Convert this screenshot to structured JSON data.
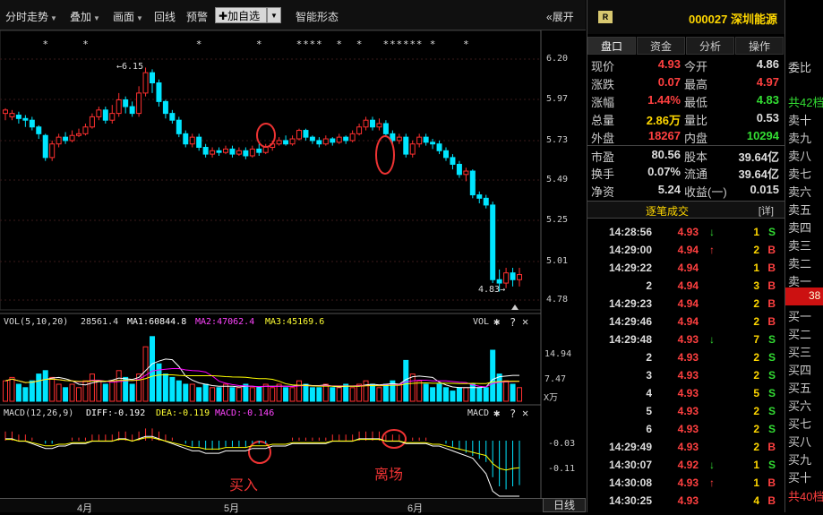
{
  "toolbar": {
    "intraday": "分时走势",
    "overlay": "叠加",
    "draw": "画面",
    "back": "回线",
    "warn": "预警",
    "add": "加自选",
    "smart": "智能形态",
    "expand": "展开"
  },
  "stock": {
    "badge": "R",
    "code": "000027",
    "name": "深圳能源"
  },
  "tabs": [
    "盘口",
    "资金",
    "分析",
    "操作"
  ],
  "quote": {
    "rows": [
      [
        {
          "l": "现价",
          "v": "4.93",
          "c": "#ff4040"
        },
        {
          "l": "今开",
          "v": "4.86",
          "c": "#ddd"
        }
      ],
      [
        {
          "l": "涨跌",
          "v": "0.07",
          "c": "#ff4040"
        },
        {
          "l": "最高",
          "v": "4.97",
          "c": "#ff4040"
        }
      ],
      [
        {
          "l": "涨幅",
          "v": "1.44%",
          "c": "#ff4040"
        },
        {
          "l": "最低",
          "v": "4.83",
          "c": "#33dd33"
        }
      ],
      [
        {
          "l": "总量",
          "v": "2.86万",
          "c": "#ffd700"
        },
        {
          "l": "量比",
          "v": "0.53",
          "c": "#ddd"
        }
      ],
      [
        {
          "l": "外盘",
          "v": "18267",
          "c": "#ff4040"
        },
        {
          "l": "内盘",
          "v": "10294",
          "c": "#33dd33"
        }
      ],
      [
        {
          "l": "市盈",
          "v": "80.56",
          "c": "#ddd"
        },
        {
          "l": "股本",
          "v": "39.64亿",
          "c": "#ddd"
        }
      ],
      [
        {
          "l": "换手",
          "v": "0.07%",
          "c": "#ddd"
        },
        {
          "l": "流通",
          "v": "39.64亿",
          "c": "#ddd"
        }
      ],
      [
        {
          "l": "净资",
          "v": "5.24",
          "c": "#ddd"
        },
        {
          "l": "收益(一)",
          "v": "0.015",
          "c": "#ddd"
        }
      ]
    ]
  },
  "ticks_header": {
    "title": "逐笔成交",
    "detail": "[详]"
  },
  "ticks": [
    {
      "t": "14:28:56",
      "p": "4.93",
      "a": "↓",
      "ac": "#33dd33",
      "q": "1",
      "s": "S"
    },
    {
      "t": "14:29:00",
      "p": "4.94",
      "a": "↑",
      "ac": "#ff4040",
      "q": "2",
      "s": "B"
    },
    {
      "t": "14:29:22",
      "p": "4.94",
      "a": "",
      "ac": "#ff4040",
      "q": "1",
      "s": "B"
    },
    {
      "t": "2",
      "p": "4.94",
      "a": "",
      "ac": "#ff4040",
      "q": "3",
      "s": "B"
    },
    {
      "t": "14:29:23",
      "p": "4.94",
      "a": "",
      "ac": "#ff4040",
      "q": "2",
      "s": "B"
    },
    {
      "t": "14:29:46",
      "p": "4.94",
      "a": "",
      "ac": "#ff4040",
      "q": "2",
      "s": "B"
    },
    {
      "t": "14:29:48",
      "p": "4.93",
      "a": "↓",
      "ac": "#33dd33",
      "q": "7",
      "s": "S"
    },
    {
      "t": "2",
      "p": "4.93",
      "a": "",
      "ac": "#ff4040",
      "q": "2",
      "s": "S"
    },
    {
      "t": "3",
      "p": "4.93",
      "a": "",
      "ac": "#ff4040",
      "q": "2",
      "s": "S"
    },
    {
      "t": "4",
      "p": "4.93",
      "a": "",
      "ac": "#ff4040",
      "q": "5",
      "s": "S"
    },
    {
      "t": "5",
      "p": "4.93",
      "a": "",
      "ac": "#ff4040",
      "q": "2",
      "s": "S"
    },
    {
      "t": "6",
      "p": "4.93",
      "a": "",
      "ac": "#ff4040",
      "q": "2",
      "s": "S"
    },
    {
      "t": "14:29:49",
      "p": "4.93",
      "a": "",
      "ac": "#ff4040",
      "q": "2",
      "s": "B"
    },
    {
      "t": "14:30:07",
      "p": "4.92",
      "a": "↓",
      "ac": "#33dd33",
      "q": "1",
      "s": "S"
    },
    {
      "t": "14:30:08",
      "p": "4.93",
      "a": "↑",
      "ac": "#ff4040",
      "q": "1",
      "s": "B"
    },
    {
      "t": "14:30:25",
      "p": "4.93",
      "a": "",
      "ac": "#ff4040",
      "q": "4",
      "s": "B"
    }
  ],
  "orderbook": {
    "ratio": "委比",
    "sell_total": "共42档",
    "sells": [
      "卖十",
      "卖九",
      "卖八",
      "卖七",
      "卖六",
      "卖五",
      "卖四",
      "卖三",
      "卖二",
      "卖一"
    ],
    "mid": "38",
    "buys": [
      "买一",
      "买二",
      "买三",
      "买四",
      "买五",
      "买六",
      "买七",
      "买八",
      "买九",
      "买十"
    ],
    "buy_total": "共40档"
  },
  "price_axis": [
    "6.20",
    "5.97",
    "5.73",
    "5.49",
    "5.25",
    "5.01",
    "4.78"
  ],
  "labels": {
    "hi": "←6.15",
    "lo": "4.83→"
  },
  "vol": {
    "title": "VOL(5,10,20)",
    "val": "28561.4",
    "ma1": "MA1:60844.8",
    "ma2": "MA2:47062.4",
    "ma3": "MA3:45169.6",
    "btn": "VOL",
    "axis": [
      "14.94",
      "7.47"
    ],
    "unit": "X万"
  },
  "macd": {
    "title": "MACD(12,26,9)",
    "diff": "DIFF:-0.192",
    "dea": "DEA:-0.119",
    "macdv": "MACD:-0.146",
    "btn": "MACD",
    "axis": [
      "-0.03",
      "-0.11"
    ]
  },
  "ann": {
    "buy": "买入",
    "sell": "离场"
  },
  "months": [
    "4月",
    "5月",
    "6月"
  ],
  "period": "日线",
  "colors": {
    "up": "#ff3030",
    "down": "#00e5ff",
    "ma1": "#ffffff",
    "ma2": "#ffff00",
    "ma3": "#ff00ff",
    "macdma": "#33ff33"
  },
  "chart_data": {
    "type": "candlestick",
    "ylim": [
      4.78,
      6.2
    ],
    "hi": 6.15,
    "lo": 4.83,
    "candles": [
      [
        5.88,
        5.9,
        5.84,
        5.91
      ],
      [
        5.86,
        5.88,
        5.84,
        5.9
      ],
      [
        5.87,
        5.85,
        5.82,
        5.89
      ],
      [
        5.85,
        5.84,
        5.8,
        5.87
      ],
      [
        5.84,
        5.8,
        5.78,
        5.86
      ],
      [
        5.8,
        5.76,
        5.73,
        5.81
      ],
      [
        5.75,
        5.62,
        5.6,
        5.76
      ],
      [
        5.62,
        5.7,
        5.6,
        5.72
      ],
      [
        5.7,
        5.74,
        5.68,
        5.76
      ],
      [
        5.74,
        5.72,
        5.7,
        5.77
      ],
      [
        5.72,
        5.75,
        5.71,
        5.78
      ],
      [
        5.75,
        5.76,
        5.74,
        5.79
      ],
      [
        5.76,
        5.8,
        5.75,
        5.82
      ],
      [
        5.8,
        5.86,
        5.79,
        5.88
      ],
      [
        5.86,
        5.9,
        5.84,
        5.92
      ],
      [
        5.9,
        5.84,
        5.82,
        5.92
      ],
      [
        5.84,
        5.88,
        5.82,
        5.93
      ],
      [
        5.88,
        5.96,
        5.86,
        6.0
      ],
      [
        5.96,
        5.92,
        5.88,
        5.98
      ],
      [
        5.92,
        5.88,
        5.86,
        5.95
      ],
      [
        5.88,
        6.0,
        5.86,
        6.04
      ],
      [
        6.0,
        6.12,
        5.98,
        6.15
      ],
      [
        6.12,
        6.06,
        6.0,
        6.14
      ],
      [
        6.06,
        5.95,
        5.92,
        6.08
      ],
      [
        5.95,
        5.88,
        5.85,
        5.96
      ],
      [
        5.88,
        5.84,
        5.82,
        5.9
      ],
      [
        5.84,
        5.76,
        5.74,
        5.86
      ],
      [
        5.76,
        5.7,
        5.68,
        5.78
      ],
      [
        5.7,
        5.74,
        5.68,
        5.76
      ],
      [
        5.74,
        5.68,
        5.66,
        5.76
      ],
      [
        5.68,
        5.64,
        5.62,
        5.7
      ],
      [
        5.64,
        5.66,
        5.62,
        5.68
      ],
      [
        5.66,
        5.65,
        5.63,
        5.68
      ],
      [
        5.65,
        5.67,
        5.64,
        5.69
      ],
      [
        5.67,
        5.64,
        5.62,
        5.69
      ],
      [
        5.64,
        5.66,
        5.63,
        5.68
      ],
      [
        5.66,
        5.63,
        5.61,
        5.68
      ],
      [
        5.63,
        5.67,
        5.62,
        5.69
      ],
      [
        5.67,
        5.65,
        5.63,
        5.7
      ],
      [
        5.65,
        5.68,
        5.64,
        5.7
      ],
      [
        5.68,
        5.7,
        5.66,
        5.72
      ],
      [
        5.7,
        5.72,
        5.69,
        5.74
      ],
      [
        5.72,
        5.7,
        5.69,
        5.75
      ],
      [
        5.7,
        5.73,
        5.69,
        5.75
      ],
      [
        5.73,
        5.78,
        5.72,
        5.79
      ],
      [
        5.78,
        5.74,
        5.72,
        5.79
      ],
      [
        5.74,
        5.72,
        5.7,
        5.75
      ],
      [
        5.72,
        5.7,
        5.68,
        5.74
      ],
      [
        5.7,
        5.73,
        5.69,
        5.75
      ],
      [
        5.73,
        5.71,
        5.69,
        5.74
      ],
      [
        5.71,
        5.74,
        5.7,
        5.76
      ],
      [
        5.74,
        5.72,
        5.7,
        5.75
      ],
      [
        5.72,
        5.76,
        5.71,
        5.78
      ],
      [
        5.76,
        5.8,
        5.75,
        5.82
      ],
      [
        5.8,
        5.84,
        5.78,
        5.86
      ],
      [
        5.84,
        5.8,
        5.78,
        5.86
      ],
      [
        5.8,
        5.82,
        5.78,
        5.85
      ],
      [
        5.82,
        5.76,
        5.74,
        5.84
      ],
      [
        5.76,
        5.72,
        5.7,
        5.78
      ],
      [
        5.72,
        5.74,
        5.7,
        5.76
      ],
      [
        5.74,
        5.64,
        5.62,
        5.76
      ],
      [
        5.64,
        5.7,
        5.62,
        5.72
      ],
      [
        5.7,
        5.74,
        5.68,
        5.76
      ],
      [
        5.74,
        5.71,
        5.69,
        5.76
      ],
      [
        5.71,
        5.7,
        5.67,
        5.73
      ],
      [
        5.7,
        5.66,
        5.64,
        5.72
      ],
      [
        5.66,
        5.62,
        5.6,
        5.68
      ],
      [
        5.62,
        5.58,
        5.55,
        5.64
      ],
      [
        5.58,
        5.52,
        5.5,
        5.6
      ],
      [
        5.52,
        5.54,
        5.48,
        5.56
      ],
      [
        5.54,
        5.4,
        5.38,
        5.55
      ],
      [
        5.4,
        5.38,
        5.35,
        5.42
      ],
      [
        5.38,
        5.34,
        5.32,
        5.4
      ],
      [
        5.34,
        4.9,
        4.88,
        5.36
      ],
      [
        4.9,
        4.88,
        4.83,
        4.96
      ],
      [
        4.88,
        4.94,
        4.85,
        4.97
      ],
      [
        4.94,
        4.9,
        4.86,
        4.97
      ],
      [
        4.9,
        4.93,
        4.86,
        4.97
      ]
    ],
    "volume": [
      6,
      7,
      5,
      4,
      6,
      8,
      9,
      7,
      5,
      4,
      5,
      4,
      6,
      8,
      6,
      5,
      6,
      9,
      7,
      5,
      8,
      16,
      19,
      11,
      8,
      7,
      6,
      5,
      5,
      4,
      5,
      4,
      4,
      5,
      4,
      4,
      5,
      4,
      4,
      5,
      4,
      5,
      4,
      4,
      6,
      5,
      4,
      4,
      5,
      4,
      4,
      5,
      4,
      5,
      6,
      5,
      4,
      5,
      6,
      5,
      12,
      8,
      6,
      5,
      4,
      5,
      4,
      3,
      4,
      4,
      5,
      4,
      4,
      15,
      8,
      6,
      5,
      4
    ],
    "macd": [
      0.03,
      0.03,
      0.02,
      0.02,
      0.01,
      0.0,
      -0.01,
      -0.01,
      0.0,
      0.0,
      0.01,
      0.01,
      0.01,
      0.02,
      0.02,
      0.02,
      0.02,
      0.03,
      0.03,
      0.02,
      0.03,
      0.04,
      0.04,
      0.03,
      0.02,
      0.01,
      0.0,
      -0.01,
      -0.02,
      -0.02,
      -0.03,
      -0.03,
      -0.03,
      -0.02,
      -0.02,
      -0.02,
      -0.02,
      -0.01,
      -0.01,
      -0.01,
      0.0,
      0.0,
      0.0,
      0.01,
      0.01,
      0.01,
      0.01,
      0.01,
      0.01,
      0.02,
      0.02,
      0.02,
      0.02,
      0.03,
      0.03,
      0.03,
      0.03,
      0.02,
      0.02,
      0.02,
      0.01,
      0.01,
      0.01,
      0.01,
      0.0,
      0.0,
      -0.01,
      -0.02,
      -0.03,
      -0.04,
      -0.05,
      -0.06,
      -0.07,
      -0.12,
      -0.15,
      -0.16,
      -0.15,
      -0.146
    ]
  }
}
